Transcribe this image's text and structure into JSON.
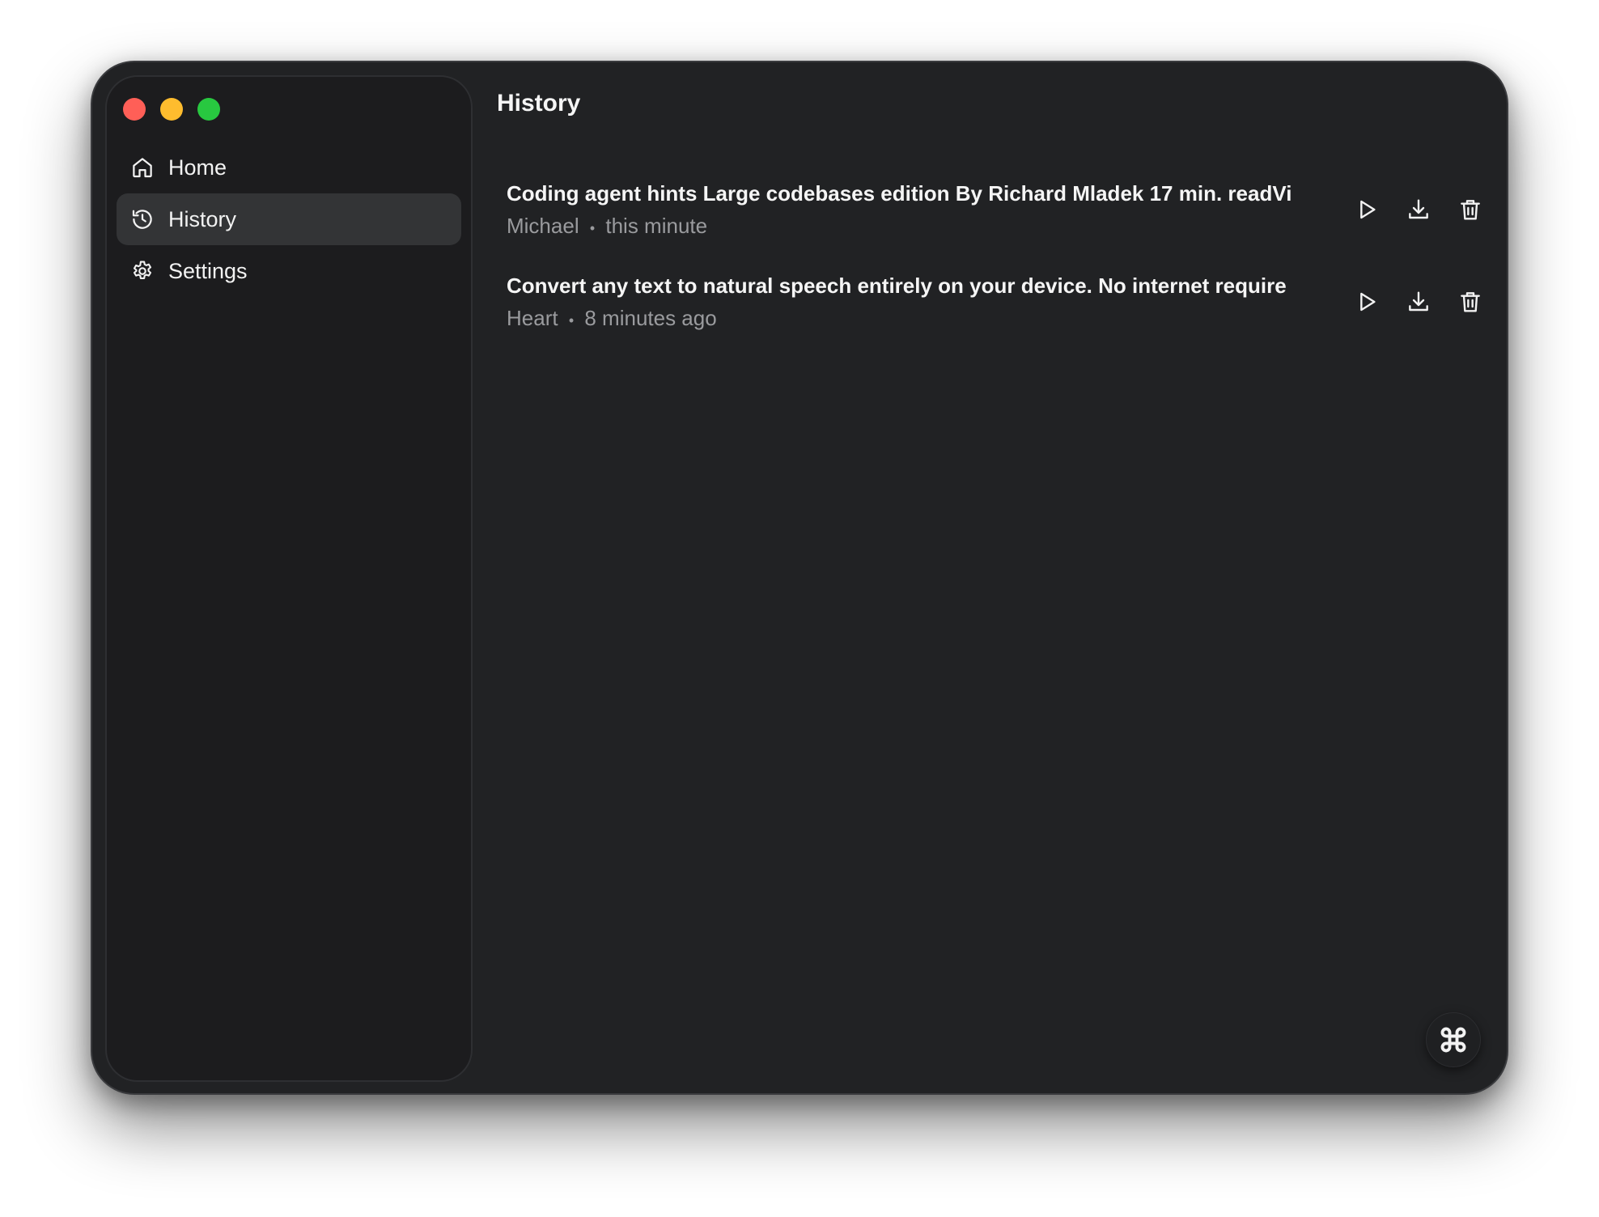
{
  "window": {
    "controls": [
      {
        "name": "close",
        "color": "#ff5f57"
      },
      {
        "name": "minimize",
        "color": "#febc2e"
      },
      {
        "name": "zoom",
        "color": "#28c840"
      }
    ]
  },
  "sidebar": {
    "items": [
      {
        "label": "Home",
        "icon": "home-icon",
        "active": false
      },
      {
        "label": "History",
        "icon": "history-icon",
        "active": true
      },
      {
        "label": "Settings",
        "icon": "gear-icon",
        "active": false
      }
    ]
  },
  "main": {
    "title": "History",
    "rows": [
      {
        "title": "Coding agent hints Large codebases edition By Richard Mladek 17 min. readVi",
        "voice": "Michael",
        "separator": "•",
        "time": "this minute"
      },
      {
        "title": "Convert any text to natural speech entirely on your device. No internet require",
        "voice": "Heart",
        "separator": "•",
        "time": "8 minutes ago"
      }
    ],
    "actions": [
      "play-icon",
      "download-icon",
      "trash-icon"
    ]
  },
  "fab": {
    "icon": "command-icon"
  }
}
